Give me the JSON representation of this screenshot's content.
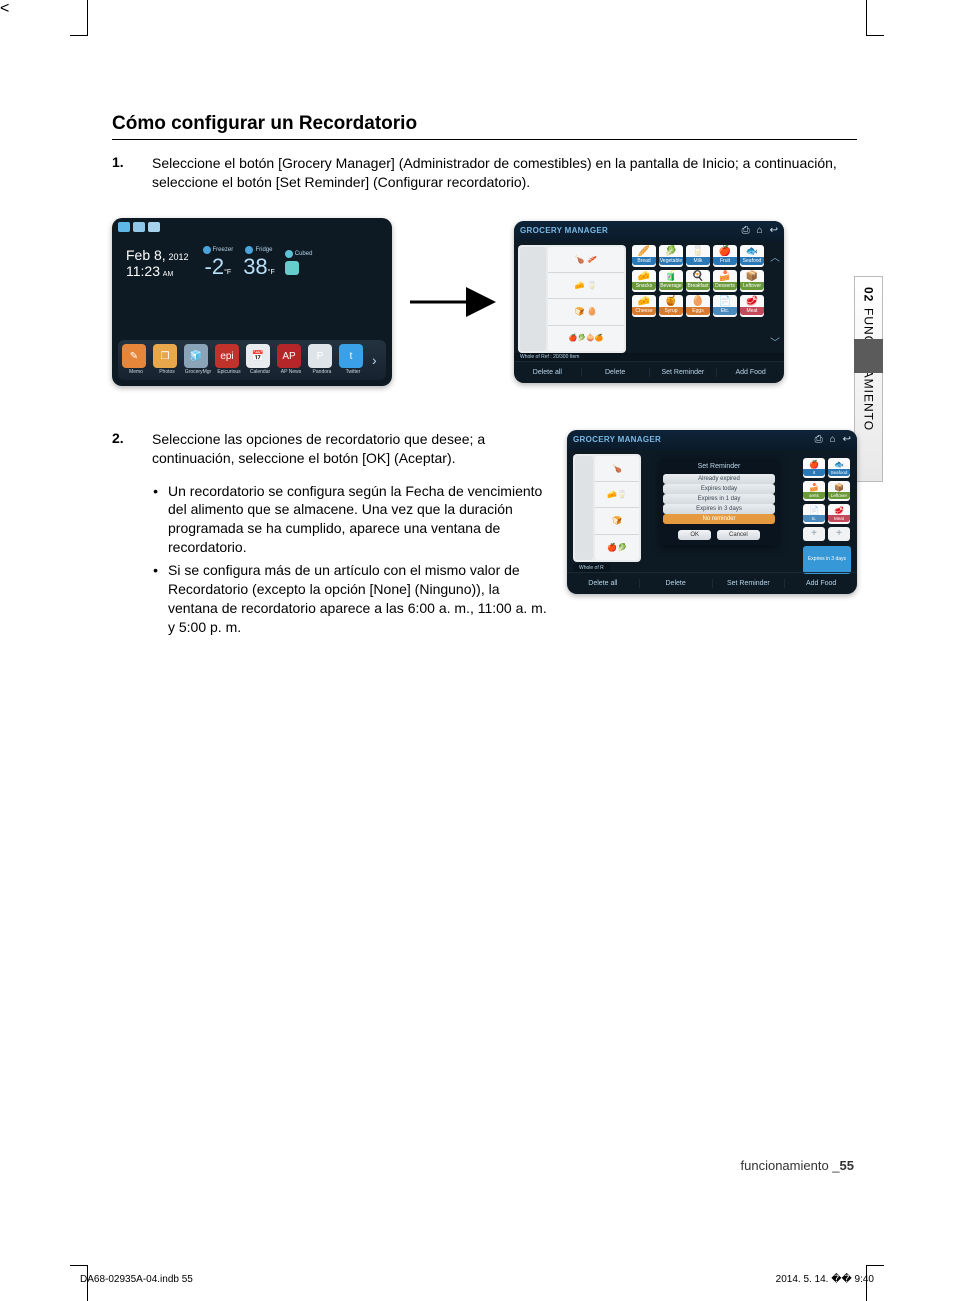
{
  "section_title": "Cómo configurar un Recordatorio",
  "step1": {
    "num": "1.",
    "text": "Seleccione el botón [Grocery Manager] (Administrador de comestibles) en la pantalla de Inicio; a continuación, seleccione el botón [Set Reminder] (Configurar recordatorio)."
  },
  "step2": {
    "num": "2.",
    "text": "Seleccione las opciones de recordatorio que desee; a continuación, seleccione el botón [OK] (Aceptar).",
    "bullets": [
      "Un recordatorio se configura según la Fecha de vencimiento del alimento que se almacene. Una vez que la duración programada se ha cumplido, aparece una ventana de recordatorio.",
      "Si se configura más de un artículo con el mismo valor de Recordatorio (excepto la opción [None] (Ninguno)), la ventana de recordatorio aparece a las 6:00 a. m., 11:00 a. m. y 5:00 p. m."
    ]
  },
  "home_screen": {
    "date": "Feb 8,",
    "year": "2012",
    "time": "11:23",
    "ampm": "AM",
    "freezer_label": "Freezer",
    "fridge_label": "Fridge",
    "cubed_label": "Cubed",
    "freezer_temp": "-2",
    "fridge_temp": "38",
    "temp_unit": "°F",
    "apps": [
      {
        "label": "Memo",
        "color": "#e6863a",
        "glyph": "✎"
      },
      {
        "label": "Photos",
        "color": "#e9a74c",
        "glyph": "❒"
      },
      {
        "label": "GroceryMgr",
        "color": "#8aa3b6",
        "glyph": "🧊"
      },
      {
        "label": "Epicurious",
        "color": "#c1322a",
        "glyph": "epi"
      },
      {
        "label": "Calendar",
        "color": "#e9ecef",
        "glyph": "📅"
      },
      {
        "label": "AP News",
        "color": "#b5262a",
        "glyph": "AP"
      },
      {
        "label": "Pandora",
        "color": "#dfe4e8",
        "glyph": "P"
      },
      {
        "label": "Twitter",
        "color": "#3aa0e8",
        "glyph": "t"
      }
    ]
  },
  "gm": {
    "title": "GROCERY MANAGER",
    "status": "Whole of Ref : 20/300 Item",
    "footer": [
      "Delete all",
      "Delete",
      "Set Reminder",
      "Add Food"
    ],
    "categories": [
      [
        {
          "label": "Bread",
          "glyph": "🥖",
          "cap": "cap-b"
        },
        {
          "label": "Vegetable",
          "glyph": "🥬",
          "cap": "cap-b"
        },
        {
          "label": "Milk",
          "glyph": "🥛",
          "cap": "cap-b"
        },
        {
          "label": "Fruit",
          "glyph": "🍎",
          "cap": "cap-b"
        },
        {
          "label": "Seafood",
          "glyph": "🐟",
          "cap": "cap-b"
        }
      ],
      [
        {
          "label": "Snacks",
          "glyph": "🧀",
          "cap": "cap-g"
        },
        {
          "label": "Beverage",
          "glyph": "🧃",
          "cap": "cap-g"
        },
        {
          "label": "Breakfast",
          "glyph": "🍳",
          "cap": "cap-g"
        },
        {
          "label": "Desserts",
          "glyph": "🍰",
          "cap": "cap-g"
        },
        {
          "label": "Leftover",
          "glyph": "📦",
          "cap": "cap-g"
        }
      ],
      [
        {
          "label": "Cheese",
          "glyph": "🧀",
          "cap": "cap-o"
        },
        {
          "label": "Syrup",
          "glyph": "🍯",
          "cap": "cap-o"
        },
        {
          "label": "Eggs",
          "glyph": "🥚",
          "cap": "cap-o"
        },
        {
          "label": "Etc.",
          "glyph": "📄",
          "cap": "cap-d"
        },
        {
          "label": "Meat",
          "glyph": "🥩",
          "cap": "cap-r"
        }
      ]
    ]
  },
  "reminder": {
    "title": "Set Reminder",
    "options": [
      "Already expired",
      "Expires today",
      "Expires in 1 day",
      "Expires in 3 days",
      "No reminder"
    ],
    "selected_index": 4,
    "ok": "OK",
    "cancel": "Cancel",
    "status": "Whole of R",
    "side_categories": [
      [
        {
          "label": "it",
          "glyph": "🍎",
          "cap": "cap-b"
        },
        {
          "label": "Seafood",
          "glyph": "🐟",
          "cap": "cap-b"
        }
      ],
      [
        {
          "label": "serts",
          "glyph": "🍰",
          "cap": "cap-g"
        },
        {
          "label": "Leftover",
          "glyph": "📦",
          "cap": "cap-g"
        }
      ],
      [
        {
          "label": "tc.",
          "glyph": "📄",
          "cap": "cap-d"
        },
        {
          "label": "Meat",
          "glyph": "🥩",
          "cap": "cap-r"
        }
      ]
    ],
    "expires_label": "Expires in 3 days"
  },
  "side_tab": {
    "num": "02",
    "label": "FUNCIONAMIENTO"
  },
  "page_footer": {
    "label": "funcionamiento _",
    "num": "55"
  },
  "print_meta": {
    "left": "DA68-02935A-04.indb   55",
    "right": "2014. 5. 14.   �� 9:40"
  }
}
